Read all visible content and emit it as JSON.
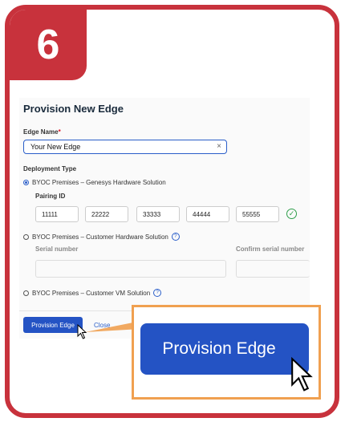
{
  "step": {
    "number": "6"
  },
  "dialog": {
    "title": "Provision New Edge",
    "edge_name": {
      "label": "Edge Name",
      "required_mark": "*",
      "value": "Your New Edge",
      "clear_icon": "×"
    },
    "deployment_type": {
      "label": "Deployment Type",
      "options": [
        {
          "label": "BYOC Premises – Genesys Hardware Solution",
          "selected": true
        },
        {
          "label": "BYOC Premises – Customer Hardware Solution",
          "selected": false
        },
        {
          "label": "BYOC Premises – Customer VM Solution",
          "selected": false
        }
      ]
    },
    "pairing_id": {
      "label": "Pairing ID",
      "values": [
        "11111",
        "22222",
        "33333",
        "44444",
        "55555"
      ]
    },
    "serial_number": {
      "label": "Serial number"
    },
    "confirm_serial": {
      "label": "Confirm serial number"
    },
    "help_icon": "?",
    "check_icon": "✓",
    "buttons": {
      "provision": "Provision Edge",
      "close": "Close"
    }
  },
  "zoom": {
    "button_label": "Provision Edge"
  },
  "colors": {
    "frame": "#c8323c",
    "primary": "#2453c4",
    "highlight": "#f0a050",
    "success": "#2e9e4a"
  }
}
